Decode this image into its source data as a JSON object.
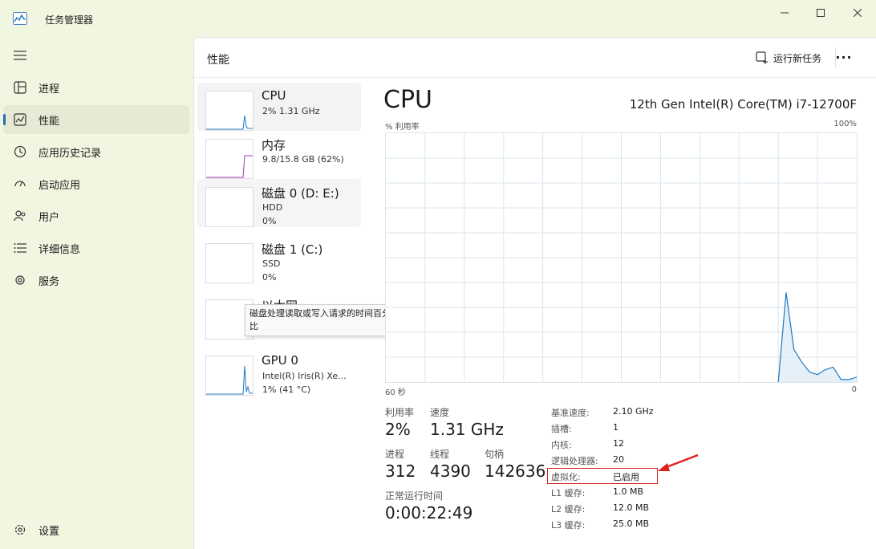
{
  "window": {
    "title": "任务管理器"
  },
  "nav": {
    "menu_icon": "hamburger-icon",
    "items": [
      {
        "label": "进程",
        "icon": "processes-icon"
      },
      {
        "label": "性能",
        "icon": "performance-icon",
        "active": true
      },
      {
        "label": "应用历史记录",
        "icon": "history-icon"
      },
      {
        "label": "启动应用",
        "icon": "startup-icon"
      },
      {
        "label": "用户",
        "icon": "users-icon"
      },
      {
        "label": "详细信息",
        "icon": "details-icon"
      },
      {
        "label": "服务",
        "icon": "services-icon"
      }
    ],
    "settings_label": "设置"
  },
  "header": {
    "title": "性能",
    "run_task_label": "运行新任务",
    "more_label": "···"
  },
  "devices": [
    {
      "name": "CPU",
      "sub1": "2% 1.31 GHz",
      "sub2": ""
    },
    {
      "name": "内存",
      "sub1": "9.8/15.8 GB (62%)",
      "sub2": ""
    },
    {
      "name": "磁盘 0 (D: E:)",
      "sub1": "HDD",
      "sub2": "0%"
    },
    {
      "name": "磁盘 1 (C:)",
      "sub1": "SSD",
      "sub2": "0%"
    },
    {
      "name": "以太网",
      "sub1": "",
      "sub2": ""
    },
    {
      "name": "GPU 0",
      "sub1": "Intel(R) Iris(R) Xe...",
      "sub2": "1% (41 °C)"
    }
  ],
  "tooltip": {
    "line1": "磁盘处理读取或写入请求的时间百分",
    "line2": "比"
  },
  "detail": {
    "title": "CPU",
    "model": "12th Gen Intel(R) Core(TM) i7-12700F",
    "y_axis_label": "% 利用率",
    "y_axis_max": "100%",
    "x_axis_left": "60 秒",
    "x_axis_right": "0",
    "stats": {
      "utilization_label": "利用率",
      "utilization": "2%",
      "speed_label": "速度",
      "speed": "1.31 GHz",
      "processes_label": "进程",
      "processes": "312",
      "threads_label": "线程",
      "threads": "4390",
      "handles_label": "句柄",
      "handles": "142636",
      "uptime_label": "正常运行时间",
      "uptime": "0:00:22:49"
    },
    "specs": [
      {
        "label": "基准速度:",
        "value": "2.10 GHz"
      },
      {
        "label": "插槽:",
        "value": "1"
      },
      {
        "label": "内核:",
        "value": "12"
      },
      {
        "label": "逻辑处理器:",
        "value": "20"
      },
      {
        "label": "虚拟化:",
        "value": "已启用"
      },
      {
        "label": "L1 缓存:",
        "value": "1.0 MB"
      },
      {
        "label": "L2 缓存:",
        "value": "12.0 MB"
      },
      {
        "label": "L3 缓存:",
        "value": "25.0 MB"
      }
    ]
  },
  "chart_data": {
    "type": "area",
    "ylabel": "% 利用率",
    "ylim": [
      0,
      100
    ],
    "x": [
      60,
      59,
      58,
      57,
      56,
      55,
      54,
      53,
      52,
      51,
      50,
      49,
      48,
      47,
      46,
      45,
      44,
      43,
      42,
      41,
      40,
      39,
      38,
      37,
      36,
      35,
      34,
      33,
      32,
      31,
      30,
      29,
      28,
      27,
      26,
      25,
      24,
      23,
      22,
      21,
      20,
      19,
      18,
      17,
      16,
      15,
      14,
      13,
      12,
      11,
      10,
      9,
      8,
      7,
      6,
      5,
      4,
      3,
      2,
      1,
      0
    ],
    "series": [
      {
        "values": [
          0,
          0,
          0,
          0,
          0,
          0,
          0,
          0,
          0,
          0,
          0,
          0,
          0,
          0,
          0,
          0,
          0,
          0,
          0,
          0,
          0,
          0,
          0,
          0,
          0,
          0,
          0,
          0,
          0,
          0,
          0,
          0,
          0,
          0,
          0,
          0,
          0,
          0,
          0,
          0,
          0,
          0,
          0,
          0,
          0,
          0,
          0,
          0,
          0,
          0,
          0,
          36,
          13,
          8,
          4,
          3,
          5,
          6,
          1,
          1,
          2
        ]
      }
    ],
    "grid": true,
    "colors": {
      "line": "#1f78c1",
      "fill": "#dceaf5",
      "grid": "#d9e5ee"
    }
  }
}
